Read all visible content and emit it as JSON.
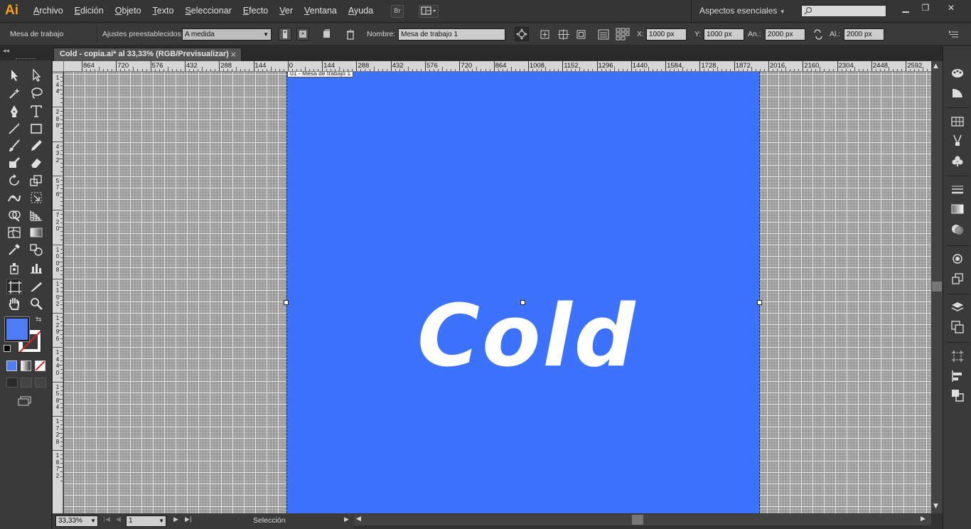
{
  "app": {
    "logo": "Ai"
  },
  "menu": [
    "Archivo",
    "Edición",
    "Objeto",
    "Texto",
    "Seleccionar",
    "Efecto",
    "Ver",
    "Ventana",
    "Ayuda"
  ],
  "menubar": {
    "bridge_label": "Br",
    "workspace": "Aspectos esenciales",
    "window_controls": [
      "minimize",
      "restore",
      "close"
    ]
  },
  "control": {
    "tool_label": "Mesa de trabajo",
    "preset_label": "Ajustes preestablecidos:",
    "preset_value": "A medida",
    "name_label": "Nombre:",
    "name_value": "Mesa de trabajo 1",
    "x_label": "X:",
    "x_value": "1000 px",
    "y_label": "Y:",
    "y_value": "1000 px",
    "w_label": "An.:",
    "w_value": "2000 px",
    "h_label": "Al.:",
    "h_value": "2000 px"
  },
  "document": {
    "tab_title": "Cold - copia.ai* al 33,33% (RGB/Previsualizar)",
    "close": "×"
  },
  "ruler": {
    "top_labels": [
      "864",
      "720",
      "576",
      "432",
      "288",
      "144",
      "0",
      "144",
      "288",
      "432",
      "576",
      "720",
      "864",
      "1008",
      "1152",
      "1296",
      "1440",
      "1584",
      "1728",
      "1872",
      "2016",
      "2160",
      "2304",
      "2448",
      "2592"
    ],
    "left_labels": [
      "144",
      "288",
      "432",
      "576",
      "720",
      "1008",
      "1152",
      "1296",
      "1440",
      "1584",
      "1728",
      "1872"
    ]
  },
  "canvas": {
    "artboard_label": "01 - Mesa de trabajo 1",
    "artboard_color": "#3d72ff",
    "text": "Cold",
    "text_color": "#ffffff"
  },
  "tools": {
    "fill_color": "#4d7cf5",
    "stroke": "none-red-slash"
  },
  "status": {
    "zoom": "33,33%",
    "page": "1",
    "tool": "Selección"
  }
}
